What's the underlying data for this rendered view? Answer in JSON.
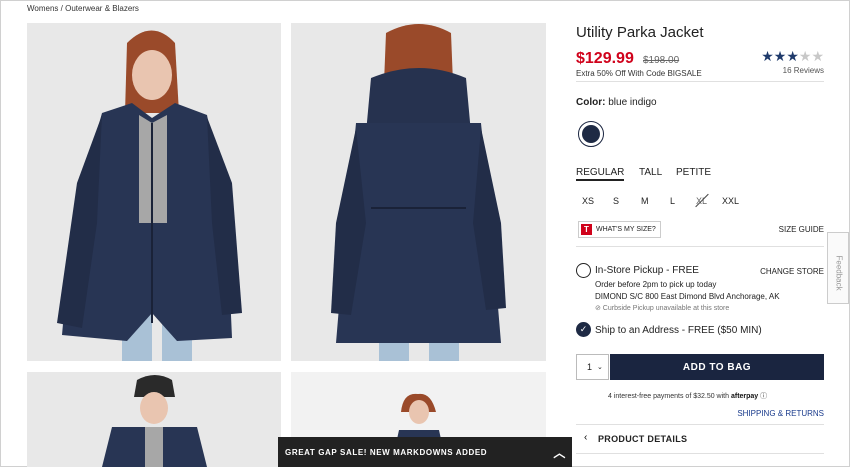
{
  "breadcrumb": {
    "part1": "Womens",
    "sep": "/",
    "part2": "Outerwear & Blazers"
  },
  "product": {
    "title": "Utility Parka Jacket",
    "price": "$129.99",
    "old_price": "$198.00",
    "promo": "Extra 50% Off With Code BIGSALE",
    "rating": {
      "filled": 3,
      "total": 5
    },
    "reviews": "16 Reviews"
  },
  "color": {
    "label": "Color:",
    "value": "blue indigo",
    "swatch_hex": "#1e2a44"
  },
  "fit_tabs": [
    "REGULAR",
    "TALL",
    "PETITE"
  ],
  "sizes": [
    "XS",
    "S",
    "M",
    "L",
    "XL",
    "XXL"
  ],
  "unavailable_size": "XL",
  "size_helper": {
    "badge": "T",
    "label": "WHAT'S MY SIZE?"
  },
  "size_guide": "SIZE GUIDE",
  "pickup": {
    "title": "In-Store Pickup - FREE",
    "change_store": "CHANGE STORE",
    "line1": "Order before 2pm to pick up today",
    "line2": "DIMOND S/C 800 East Dimond Blvd  Anchorage, AK",
    "line3": "⊘ Curbside Pickup unavailable at this store"
  },
  "ship": {
    "title": "Ship to an Address - FREE ($50 MIN)"
  },
  "quantity": "1",
  "add_to_bag": "ADD TO BAG",
  "afterpay": {
    "text": "4 interest-free payments of $32.50 with",
    "brand": "afterpay",
    "info": "ⓘ"
  },
  "shipping_returns": "SHIPPING & RETURNS",
  "product_details": "PRODUCT DETAILS",
  "feedback": "Feedback",
  "sale_banner": "GREAT GAP SALE! NEW MARKDOWNS ADDED",
  "colors": {
    "price_red": "#d0021b",
    "navy": "#1a2540",
    "star": "#1f3a6b"
  }
}
